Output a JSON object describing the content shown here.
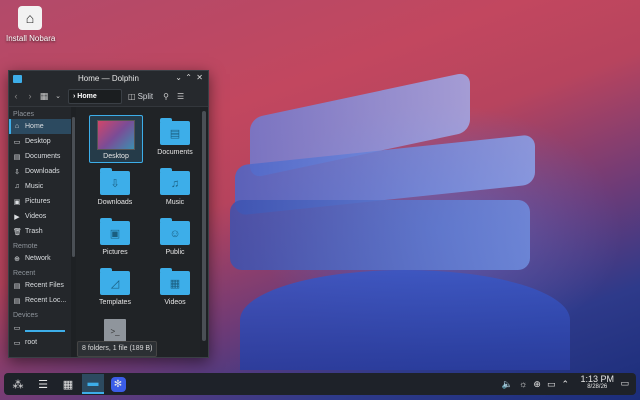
{
  "desktop": {
    "install_icon_label": "Install Nobara"
  },
  "window": {
    "title": "Home — Dolphin",
    "location": "Home",
    "split_label": "Split",
    "places": {
      "places_heading": "Places",
      "places_items": [
        "Home",
        "Desktop",
        "Documents",
        "Downloads",
        "Music",
        "Pictures",
        "Videos",
        "Trash"
      ],
      "remote_heading": "Remote",
      "remote_items": [
        "Network"
      ],
      "recent_heading": "Recent",
      "recent_items": [
        "Recent Files",
        "Recent Loc..."
      ],
      "devices_heading": "Devices",
      "device_items": [
        "root"
      ]
    },
    "files": [
      "Desktop",
      "Documents",
      "Downloads",
      "Music",
      "Pictures",
      "Public",
      "Templates",
      "Videos"
    ],
    "status": "8 folders, 1 file (189 B)"
  },
  "taskbar": {
    "time": "1:13 PM",
    "date": "8/28/26"
  },
  "colors": {
    "accent": "#3daee9",
    "window_bg": "#202326",
    "panel_bg": "#1e2229"
  }
}
